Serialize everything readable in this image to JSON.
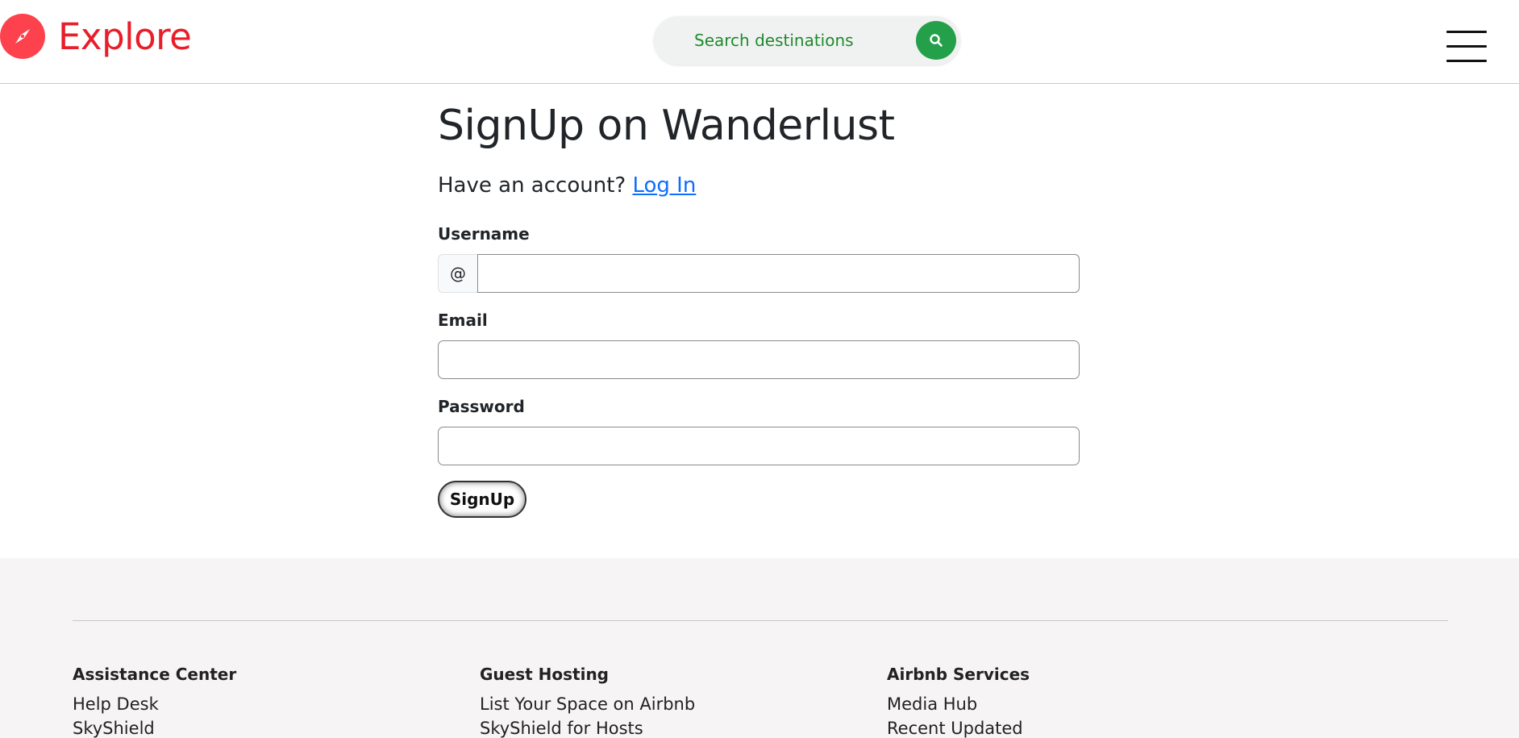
{
  "navbar": {
    "brand": "Explore",
    "search_placeholder": "Search destinations"
  },
  "signup": {
    "title": "SignUp on Wanderlust",
    "account_prompt": "Have an account?",
    "login_link": "Log In",
    "username_label": "Username",
    "username_prefix": "@",
    "email_label": "Email",
    "password_label": "Password",
    "submit_label": "SignUp"
  },
  "footer": {
    "columns": [
      {
        "heading": "Assistance Center",
        "links": [
          "Help Desk",
          "SkyShield"
        ]
      },
      {
        "heading": "Guest Hosting",
        "links": [
          "List Your Space on Airbnb",
          "SkyShield for Hosts"
        ]
      },
      {
        "heading": "Airbnb Services",
        "links": [
          "Media Hub",
          "Recent Updated"
        ]
      }
    ]
  },
  "colors": {
    "brand": "#fe424d",
    "search_button": "#25a04a",
    "link": "#0d6efd",
    "footer_bg": "#f6f4f4"
  },
  "icons": {
    "brand": "compass-icon",
    "search": "search-icon",
    "menu": "hamburger-menu-icon"
  }
}
